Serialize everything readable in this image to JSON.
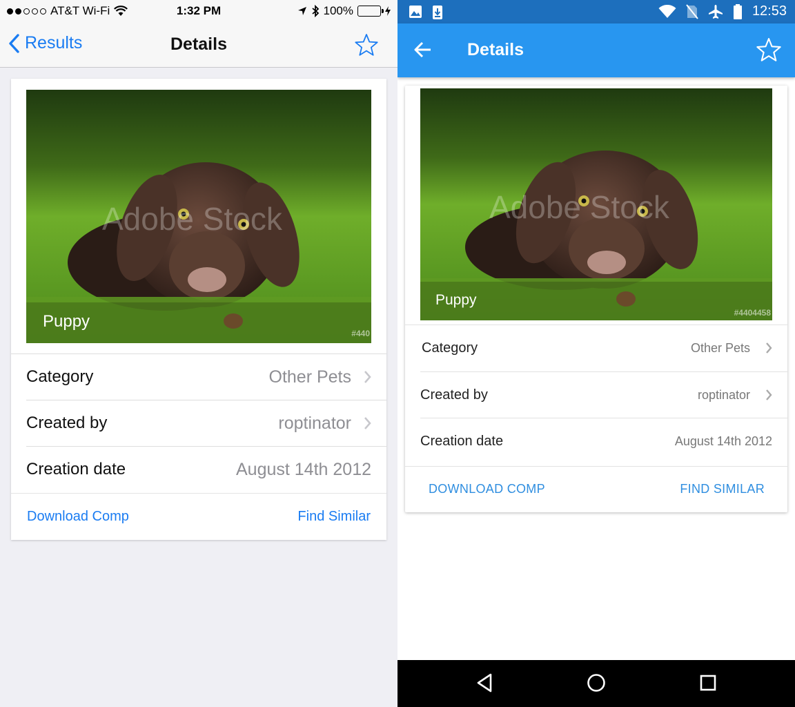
{
  "ios": {
    "status": {
      "carrier": "AT&T Wi-Fi",
      "time": "1:32 PM",
      "battery": "100%"
    },
    "nav": {
      "back_label": "Results",
      "title": "Details"
    },
    "photo": {
      "caption": "Puppy",
      "id": "#440",
      "watermark": "Adobe Stock"
    },
    "rows": [
      {
        "label": "Category",
        "value": "Other Pets"
      },
      {
        "label": "Created by",
        "value": "roptinator"
      },
      {
        "label": "Creation date",
        "value": "August 14th 2012"
      }
    ],
    "actions": {
      "download": "Download Comp",
      "similar": "Find Similar"
    }
  },
  "android": {
    "status": {
      "time": "12:53"
    },
    "bar": {
      "title": "Details"
    },
    "photo": {
      "caption": "Puppy",
      "id": "#4404458",
      "watermark": "Adobe Stock"
    },
    "rows": [
      {
        "label": "Category",
        "value": "Other Pets"
      },
      {
        "label": "Created by",
        "value": "roptinator"
      },
      {
        "label": "Creation date",
        "value": "August 14th 2012"
      }
    ],
    "actions": {
      "download": "DOWNLOAD COMP",
      "similar": "FIND SIMILAR"
    }
  },
  "colors": {
    "ios_tint": "#1a7cf2",
    "android_appbar": "#2896f0",
    "android_statusbar": "#1d6fbd",
    "android_link": "#2f8ee0"
  },
  "icons": [
    "signal-dots-icon",
    "wifi-icon",
    "location-arrow-icon",
    "bluetooth-icon",
    "battery-icon",
    "chevron-left-icon",
    "star-outline-icon",
    "chevron-right-icon",
    "image-icon",
    "download-notification-icon",
    "no-sim-icon",
    "airplane-icon",
    "arrow-back-icon",
    "nav-back-icon",
    "nav-home-icon",
    "nav-recents-icon"
  ]
}
